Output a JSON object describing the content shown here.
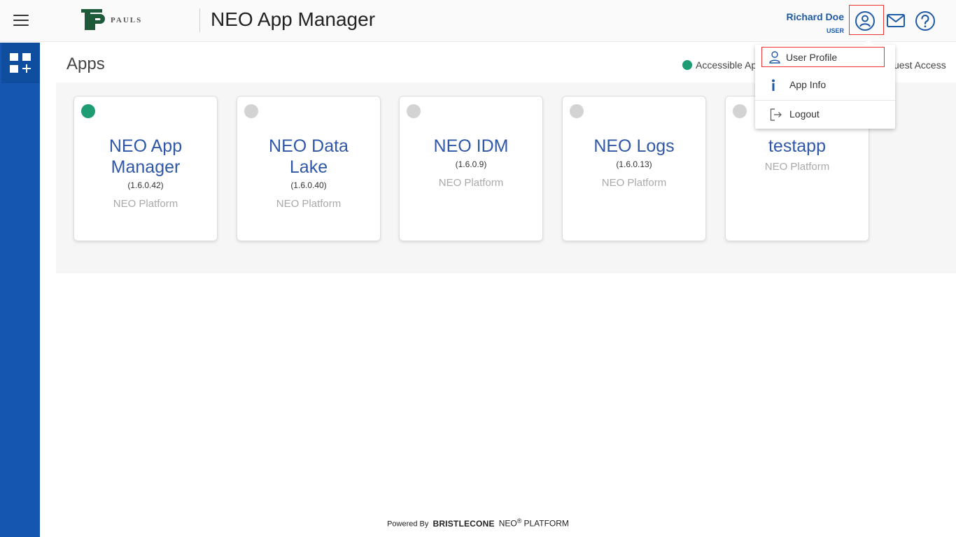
{
  "header": {
    "logo_text": "PAULS",
    "app_title": "NEO App Manager",
    "user_name": "Richard Doe",
    "user_role": "USER"
  },
  "main": {
    "page_title": "Apps",
    "legend_accessible": "Accessible Ap",
    "legend_guest": "uest Access"
  },
  "apps": [
    {
      "name_line1": "NEO App",
      "name_line2": "Manager",
      "version": "(1.6.0.42)",
      "platform": "NEO Platform",
      "accessible": true
    },
    {
      "name_line1": "NEO Data",
      "name_line2": "Lake",
      "version": "(1.6.0.40)",
      "platform": "NEO Platform",
      "accessible": false
    },
    {
      "name_line1": "NEO IDM",
      "name_line2": "",
      "version": "(1.6.0.9)",
      "platform": "NEO Platform",
      "accessible": false
    },
    {
      "name_line1": "NEO Logs",
      "name_line2": "",
      "version": "(1.6.0.13)",
      "platform": "NEO Platform",
      "accessible": false
    },
    {
      "name_line1": "testapp",
      "name_line2": "",
      "version": "",
      "platform": "NEO Platform",
      "accessible": false
    }
  ],
  "dropdown": {
    "user_profile": "User Profile",
    "app_info": "App Info",
    "logout": "Logout"
  },
  "footer": {
    "powered_by": "Powered By",
    "brand": "BRISTLECONE",
    "neo": "NEO",
    "reg": "®",
    "platform": "PLATFORM"
  },
  "colors": {
    "accent": "#1557b0",
    "accessible": "#1e9c73",
    "inaccessible": "#d3d3d3",
    "app_name": "#2f57a8"
  }
}
